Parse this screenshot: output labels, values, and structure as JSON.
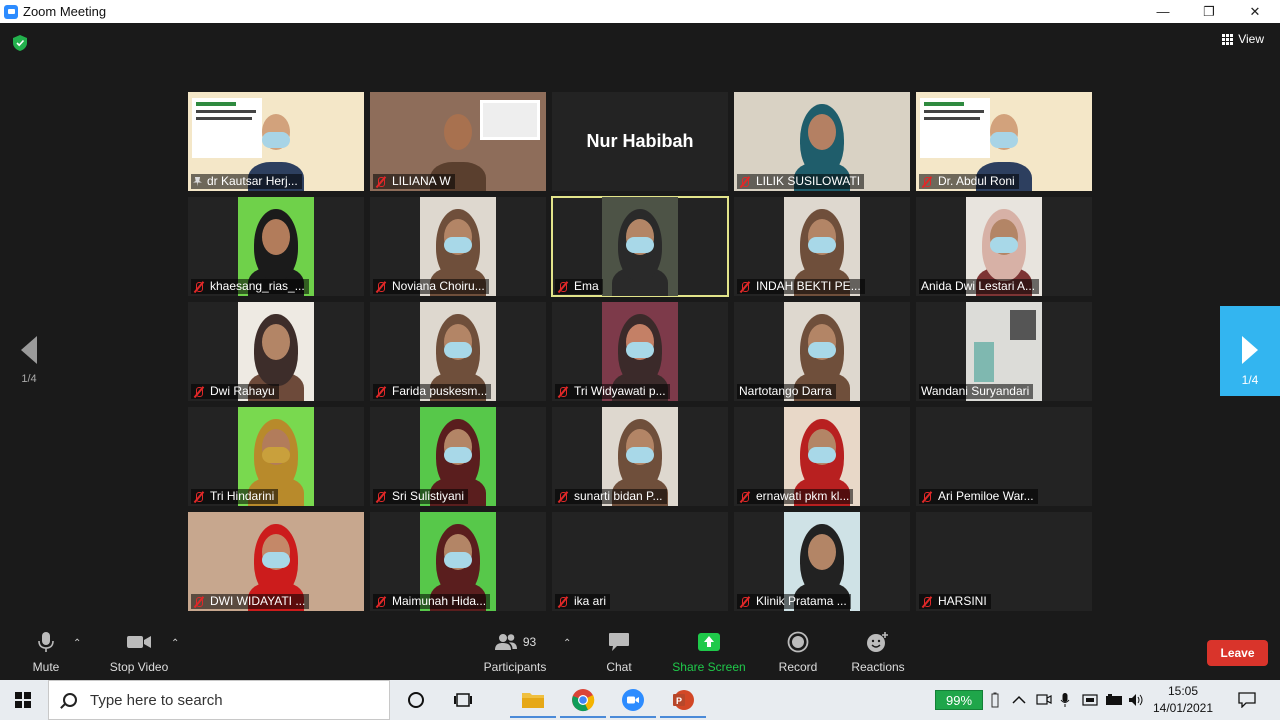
{
  "window": {
    "title": "Zoom Meeting",
    "minimize": "—",
    "maximize": "❐",
    "close": "✕"
  },
  "meeting": {
    "view_label": "View",
    "page_left": "1/4",
    "page_right": "1/4",
    "tiles": [
      {
        "name": "dr Kautsar Herj...",
        "icon": "pin-icon",
        "has_video": true,
        "scene": "slide"
      },
      {
        "name": "LILIANA W",
        "icon": "mic-muted-icon",
        "has_video": true,
        "scene": "room"
      },
      {
        "name": "Nur Habibah",
        "icon": "none",
        "has_video": false
      },
      {
        "name": "LILIK SUSILOWATI",
        "icon": "mic-muted-icon",
        "has_video": true,
        "scene": "hijab-blue"
      },
      {
        "name": "Dr. Abdul Roni",
        "icon": "mic-muted-icon",
        "has_video": true,
        "scene": "slide"
      },
      {
        "name": "khaesang_rias_...",
        "icon": "mic-muted-icon",
        "has_video": true,
        "scene": "green"
      },
      {
        "name": "Noviana Choiru...",
        "icon": "mic-muted-icon",
        "has_video": true,
        "scene": "mask"
      },
      {
        "name": "Ema",
        "icon": "mic-muted-icon",
        "has_video": true,
        "scene": "mask-dark",
        "active": true
      },
      {
        "name": "INDAH BEKTI PE...",
        "icon": "mic-muted-icon",
        "has_video": true,
        "scene": "mask"
      },
      {
        "name": "Anida Dwi Lestari A...",
        "icon": "none",
        "has_video": true,
        "scene": "mask-pink"
      },
      {
        "name": "Dwi Rahayu",
        "icon": "mic-muted-icon",
        "has_video": true,
        "scene": "plain"
      },
      {
        "name": "Farida puskesm...",
        "icon": "mic-muted-icon",
        "has_video": true,
        "scene": "mask"
      },
      {
        "name": "Tri Widyawati p...",
        "icon": "mic-muted-icon",
        "has_video": true,
        "scene": "hand"
      },
      {
        "name": "Nartotango Darra",
        "icon": "none",
        "has_video": true,
        "scene": "mask"
      },
      {
        "name": "Wandani Suryandari",
        "icon": "none",
        "has_video": true,
        "scene": "room-empty"
      },
      {
        "name": "Tri Hindarini",
        "icon": "mic-muted-icon",
        "has_video": true,
        "scene": "green-gold"
      },
      {
        "name": "Sri Sulistiyani",
        "icon": "mic-muted-icon",
        "has_video": true,
        "scene": "green-mask"
      },
      {
        "name": "sunarti bidan P...",
        "icon": "mic-muted-icon",
        "has_video": true,
        "scene": "mask"
      },
      {
        "name": "ernawati pkm kl...",
        "icon": "mic-muted-icon",
        "has_video": true,
        "scene": "mask-red"
      },
      {
        "name": "Ari Pemiloe War...",
        "icon": "mic-muted-icon",
        "has_video": false
      },
      {
        "name": "DWI WIDAYATI ...",
        "icon": "mic-muted-icon",
        "has_video": true,
        "scene": "red-wide"
      },
      {
        "name": "Maimunah Hida...",
        "icon": "mic-muted-icon",
        "has_video": true,
        "scene": "green-mask"
      },
      {
        "name": "ika ari",
        "icon": "mic-muted-icon",
        "has_video": false
      },
      {
        "name": "Klinik Pratama ...",
        "icon": "mic-muted-icon",
        "has_video": true,
        "scene": "clinic"
      },
      {
        "name": "HARSINI",
        "icon": "mic-muted-icon",
        "has_video": false
      }
    ]
  },
  "toolbar": {
    "mute": "Mute",
    "stop_video": "Stop Video",
    "participants": "Participants",
    "participants_count": "93",
    "chat": "Chat",
    "share_screen": "Share Screen",
    "record": "Record",
    "reactions": "Reactions",
    "leave": "Leave",
    "share_color": "#1fc94a",
    "leave_color": "#d9342b"
  },
  "taskbar": {
    "search_placeholder": "Type here to search",
    "battery": "99%",
    "time": "15:05",
    "date": "14/01/2021"
  }
}
